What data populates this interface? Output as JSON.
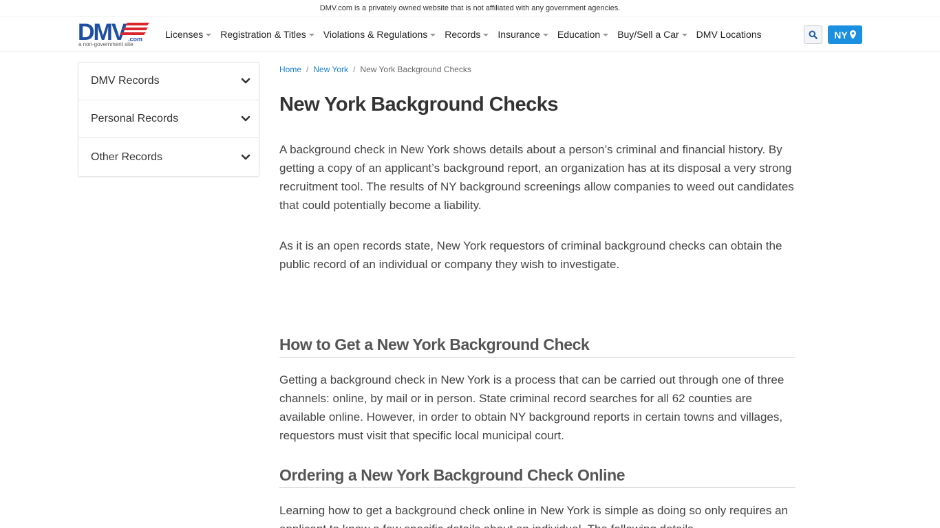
{
  "disclaimer": "DMV.com is a privately owned website that is not affiliated with any government agencies.",
  "logo": {
    "text": "DMV",
    "suffix": ".com",
    "tagline": "a non-government site"
  },
  "nav": [
    {
      "label": "Licenses",
      "dropdown": true
    },
    {
      "label": "Registration & Titles",
      "dropdown": true
    },
    {
      "label": "Violations & Regulations",
      "dropdown": true
    },
    {
      "label": "Records",
      "dropdown": true
    },
    {
      "label": "Insurance",
      "dropdown": true
    },
    {
      "label": "Education",
      "dropdown": true
    },
    {
      "label": "Buy/Sell a Car",
      "dropdown": true
    },
    {
      "label": "DMV Locations",
      "dropdown": false
    }
  ],
  "state_button": {
    "label": "NY",
    "icon": "map-pin-icon"
  },
  "search_button": {
    "icon": "search-icon"
  },
  "sidebar": [
    {
      "label": "DMV Records"
    },
    {
      "label": "Personal Records"
    },
    {
      "label": "Other Records"
    }
  ],
  "breadcrumb": {
    "home": "Home",
    "state": "New York",
    "current": "New York Background Checks",
    "separator": "/"
  },
  "content": {
    "title": "New York Background Checks",
    "intro_1": "A background check in New York shows details about a person’s criminal and financial history. By getting a copy of an applicant’s background report, an organization has at its disposal a very strong recruitment tool. The results of NY background screenings allow companies to weed out candidates that could potentially become a liability.",
    "intro_2": "As it is an open records state, New York requestors of criminal background checks can obtain the public record of an individual or company they wish to investigate.",
    "section_1_heading": "How to Get a New York Background Check",
    "section_1_text": "Getting a background check in New York is a process that can be carried out through one of three channels: online, by mail or in person. State criminal record searches for all 62 counties are available online. However, in order to obtain NY background reports in certain towns and villages, requestors must visit that specific local municipal court.",
    "section_2_heading": "Ordering a New York Background Check Online",
    "section_2_text": "Learning how to get a background check online in New York is simple as doing so only requires an applicant to know a few specific details about an individual. The following details"
  },
  "colors": {
    "accent": "#1b8fe0",
    "logo_blue": "#1f4fa3",
    "logo_red": "#d9262c",
    "link": "#1a7fcf"
  }
}
